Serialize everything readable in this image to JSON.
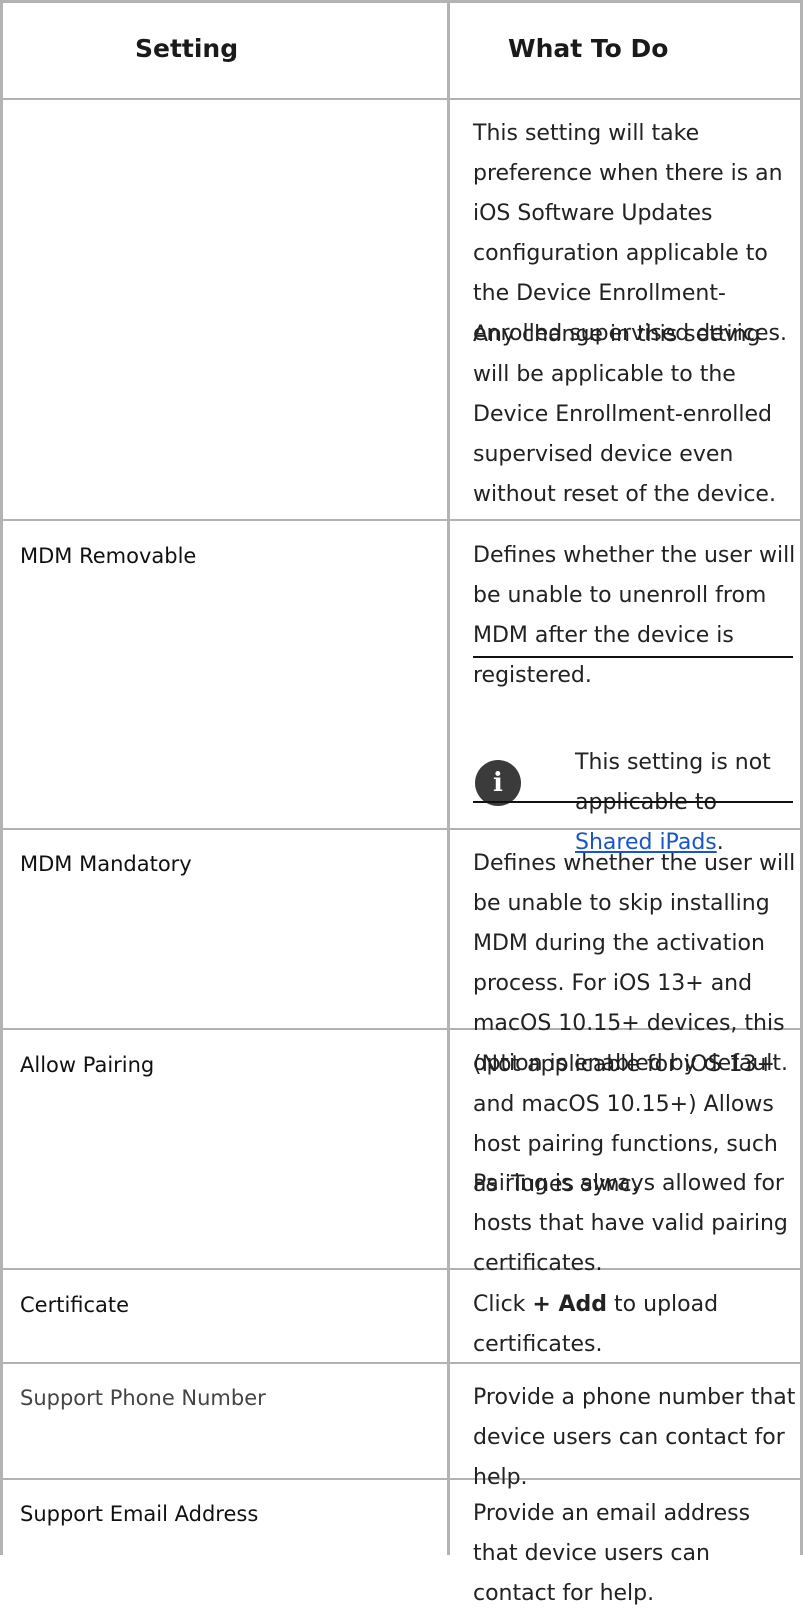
{
  "header": {
    "setting": "Setting",
    "what_to_do": "What To Do"
  },
  "rows": [
    {
      "setting": "",
      "paragraphs": [
        "This setting will take preference when there is an iOS Software Updates configuration applicable to the Device Enrollment-enrolled supervised devices.",
        "Any change in this setting will be applicable to the Device Enrollment-enrolled supervised device even without reset of the device."
      ]
    },
    {
      "setting": "MDM Removable",
      "paragraphs": [
        "Defines whether the user will be unable to unenroll from MDM after the device is registered."
      ],
      "note": {
        "text_before": "This setting is not applicable to ",
        "link": "Shared iPads",
        "text_after": ".",
        "icon": "info-icon"
      }
    },
    {
      "setting": "MDM Mandatory",
      "paragraphs": [
        "Defines whether the user will be unable to skip installing MDM during the activation process. For iOS 13+ and macOS 10.15+ devices, this option is enabled by default."
      ]
    },
    {
      "setting": "Allow Pairing",
      "paragraphs": [
        "(Not applicable for iOS 13+ and macOS 10.15+) Allows host pairing functions, such as iTunes sync.",
        "Pairing is always allowed for hosts that have valid pairing certificates."
      ]
    },
    {
      "setting": "Certificate",
      "action_before": "Click ",
      "action_bold": "+ Add",
      "action_after": " to upload certificates."
    },
    {
      "setting": "Support Phone Number",
      "paragraphs": [
        "Provide a phone number that device users can contact for help."
      ]
    },
    {
      "setting": "Support Email Address",
      "paragraphs": [
        "Provide an email address that device users can contact for help."
      ]
    }
  ],
  "colors": {
    "rule": "#b3b3b3",
    "link": "#1a55c8",
    "icon_bg": "#3b3b3b"
  }
}
